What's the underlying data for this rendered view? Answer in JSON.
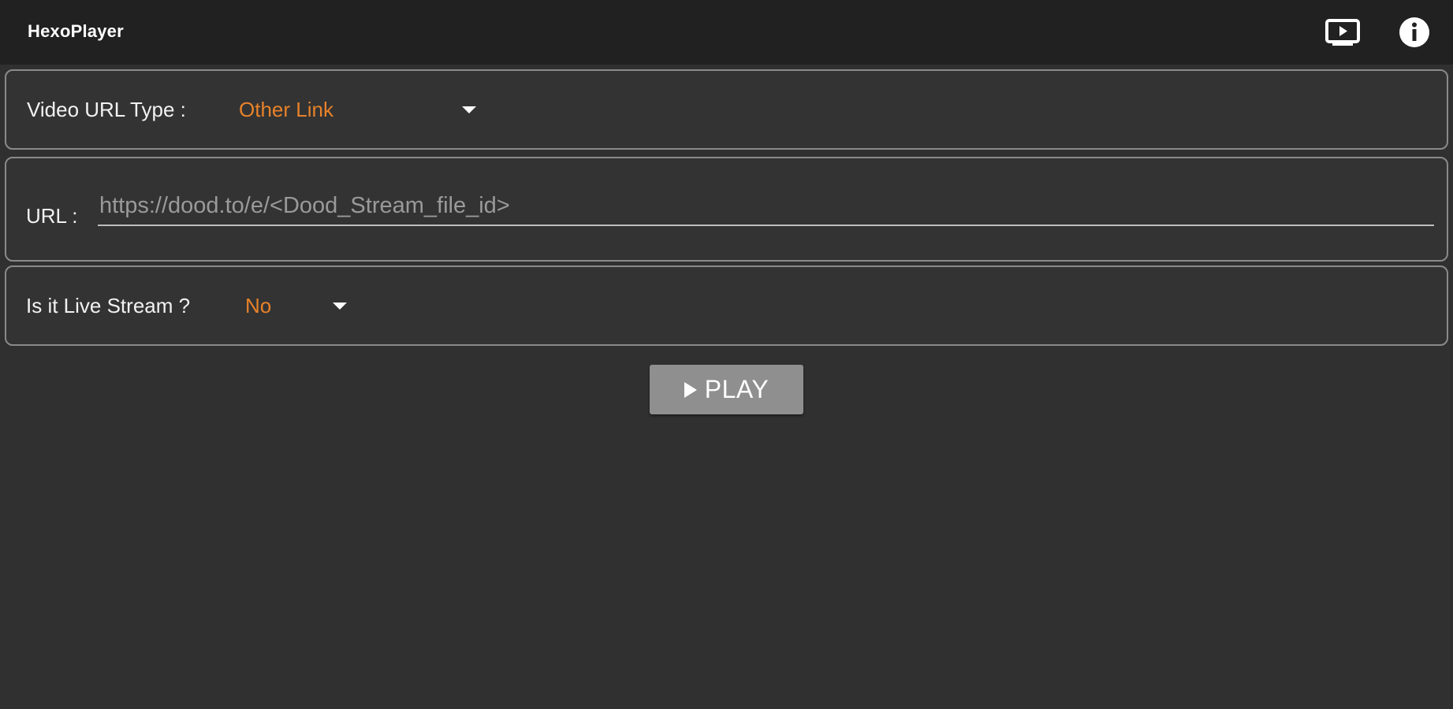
{
  "app": {
    "title": "HexoPlayer"
  },
  "toolbar": {
    "cast_icon": "tv-play-icon",
    "info_icon": "info-icon"
  },
  "video_url_type": {
    "label": "Video URL Type :",
    "selected": "Other Link"
  },
  "url": {
    "label": "URL :",
    "value": "",
    "placeholder": "https://dood.to/e/<Dood_Stream_file_id>"
  },
  "live_stream": {
    "label": "Is it Live Stream ?",
    "selected": "No"
  },
  "play_button": {
    "label": "PLAY",
    "icon": "play-icon"
  },
  "colors": {
    "accent": "#e8822a",
    "background": "#303030",
    "topbar": "#212121",
    "button": "#8f8f8f"
  }
}
